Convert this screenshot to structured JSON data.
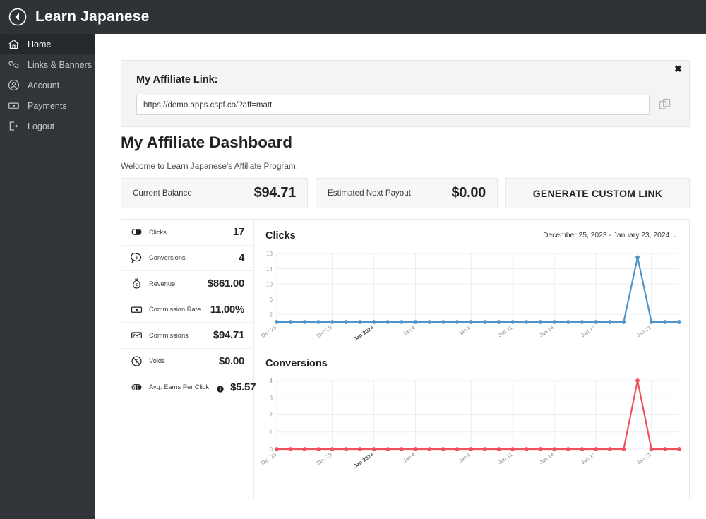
{
  "topbar": {
    "title": "Learn Japanese",
    "back_icon": "back-circle-icon"
  },
  "sidebar": {
    "items": [
      {
        "label": "Home",
        "icon": "home-icon",
        "active": true
      },
      {
        "label": "Links & Banners",
        "icon": "link-icon",
        "active": false
      },
      {
        "label": "Account",
        "icon": "person-icon",
        "active": false
      },
      {
        "label": "Payments",
        "icon": "banknote-icon",
        "active": false
      },
      {
        "label": "Logout",
        "icon": "logout-icon",
        "active": false
      }
    ]
  },
  "affiliate_panel": {
    "label": "My Affiliate Link:",
    "link_value": "https://demo.apps.cspf.co/?aff=matt",
    "link_placeholder": "https://demo.apps.cspf.co/?aff=matt",
    "copy_icon": "copy-icon",
    "close_label": "✖"
  },
  "dashboard": {
    "title": "My Affiliate Dashboard",
    "subtitle": "Welcome to Learn Japanese's Affiliate Program."
  },
  "cards": [
    {
      "label": "Current Balance",
      "value": "$94.71"
    },
    {
      "label": "Estimated Next Payout",
      "value": "$0.00"
    }
  ],
  "generate_button": {
    "label": "GENERATE CUSTOM LINK"
  },
  "stats": [
    {
      "label": "Clicks",
      "value": "17",
      "icon": "click-icon",
      "info": false
    },
    {
      "label": "Conversions",
      "value": "4",
      "icon": "conversion-icon",
      "info": false
    },
    {
      "label": "Revenue",
      "value": "$861.00",
      "icon": "moneybag-icon",
      "info": false
    },
    {
      "label": "Commission Rate",
      "value": "11.00%",
      "icon": "banknote-icon",
      "info": false
    },
    {
      "label": "Commissions",
      "value": "$94.71",
      "icon": "payout-icon",
      "info": false
    },
    {
      "label": "Voids",
      "value": "$0.00",
      "icon": "void-icon",
      "info": false
    },
    {
      "label": "Avg. Earns Per Click",
      "value": "$5.57",
      "icon": "epc-icon",
      "info": true
    }
  ],
  "date_range": {
    "label": "December 25, 2023 - January 23, 2024",
    "caret": "⌄"
  },
  "colors": {
    "clicks_line": "#4f93c8",
    "conversions_line": "#f0515c",
    "sidebar_bg": "#313539",
    "topbar_bg": "#2f3337",
    "panel_bg": "#f4f4f4"
  },
  "chart_data": [
    {
      "type": "line",
      "title": "Clicks",
      "xlabel": "",
      "ylabel": "",
      "ylim": [
        0,
        18
      ],
      "yticks": [
        2,
        6,
        10,
        14,
        18
      ],
      "grid": true,
      "legend": "none",
      "x": [
        "Dec 25",
        "Dec 26",
        "Dec 27",
        "Dec 28",
        "Dec 29",
        "Dec 30",
        "Dec 31",
        "Jan 2024",
        "Jan 2",
        "Jan 3",
        "Jan 4",
        "Jan 5",
        "Jan 6",
        "Jan 7",
        "Jan 8",
        "Jan 9",
        "Jan 10",
        "Jan 11",
        "Jan 12",
        "Jan 13",
        "Jan 14",
        "Jan 15",
        "Jan 16",
        "Jan 17",
        "Jan 18",
        "Jan 19",
        "Jan 20",
        "Jan 21",
        "Jan 22",
        "Jan 23"
      ],
      "xtick_labels": [
        "Dec 25",
        "Dec 29",
        "Jan 2024",
        "Jan 4",
        "Jan 8",
        "Jan 11",
        "Jan 14",
        "Jan 17",
        "Jan 21"
      ],
      "xtick_indices": [
        0,
        4,
        7,
        10,
        14,
        17,
        20,
        23,
        27
      ],
      "values": [
        0,
        0,
        0,
        0,
        0,
        0,
        0,
        0,
        0,
        0,
        0,
        0,
        0,
        0,
        0,
        0,
        0,
        0,
        0,
        0,
        0,
        0,
        0,
        0,
        0,
        0,
        17,
        0,
        0,
        0
      ],
      "color": "#4f93c8"
    },
    {
      "type": "line",
      "title": "Conversions",
      "xlabel": "",
      "ylabel": "",
      "ylim": [
        0,
        4
      ],
      "yticks": [
        0,
        1,
        2,
        3,
        4
      ],
      "grid": true,
      "legend": "none",
      "x": [
        "Dec 25",
        "Dec 26",
        "Dec 27",
        "Dec 28",
        "Dec 29",
        "Dec 30",
        "Dec 31",
        "Jan 2024",
        "Jan 2",
        "Jan 3",
        "Jan 4",
        "Jan 5",
        "Jan 6",
        "Jan 7",
        "Jan 8",
        "Jan 9",
        "Jan 10",
        "Jan 11",
        "Jan 12",
        "Jan 13",
        "Jan 14",
        "Jan 15",
        "Jan 16",
        "Jan 17",
        "Jan 18",
        "Jan 19",
        "Jan 20",
        "Jan 21",
        "Jan 22",
        "Jan 23"
      ],
      "xtick_labels": [
        "Dec 25",
        "Dec 29",
        "Jan 2024",
        "Jan 4",
        "Jan 8",
        "Jan 11",
        "Jan 14",
        "Jan 17",
        "Jan 21"
      ],
      "xtick_indices": [
        0,
        4,
        7,
        10,
        14,
        17,
        20,
        23,
        27
      ],
      "values": [
        0,
        0,
        0,
        0,
        0,
        0,
        0,
        0,
        0,
        0,
        0,
        0,
        0,
        0,
        0,
        0,
        0,
        0,
        0,
        0,
        0,
        0,
        0,
        0,
        0,
        0,
        4,
        0,
        0,
        0
      ],
      "color": "#f0515c"
    }
  ]
}
